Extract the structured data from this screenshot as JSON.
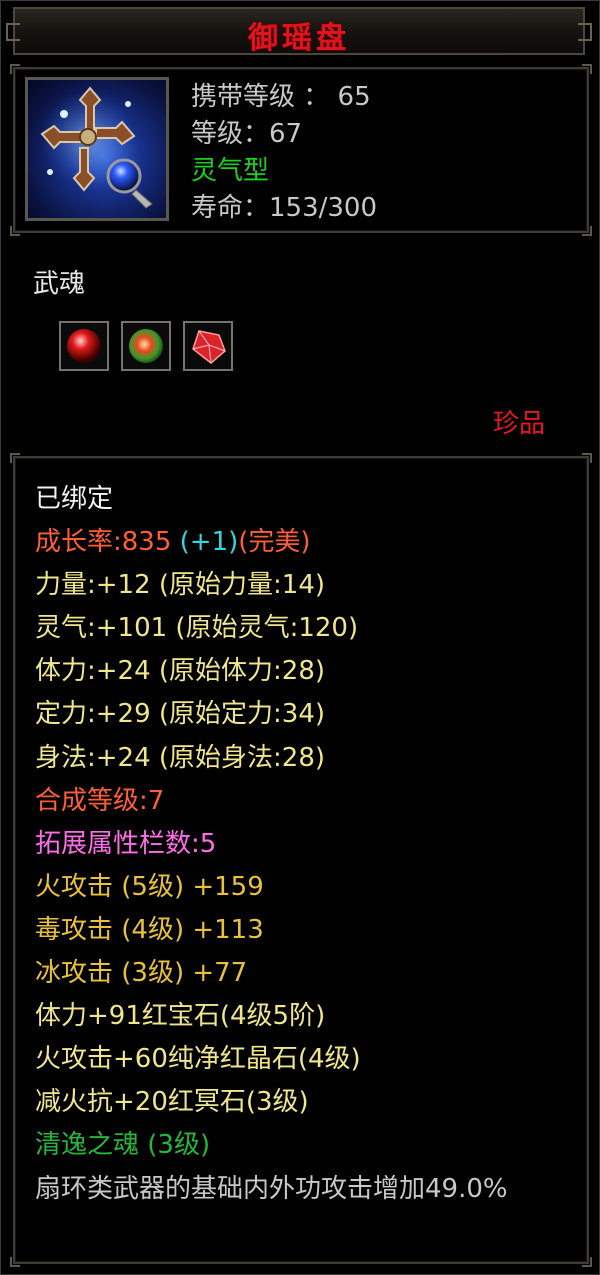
{
  "title": "御瑶盘",
  "item": {
    "icon": "fan-ring-weapon-icon",
    "carry_level": "携带等级 ： 65",
    "level": "等级：67",
    "type": "灵气型",
    "lifespan": "寿命：153/300"
  },
  "soul": {
    "label": "武魂",
    "gems": [
      "red-orb-gem-icon",
      "green-orb-gem-icon",
      "red-crystal-gem-icon"
    ]
  },
  "rarity": "珍品",
  "attributes": {
    "bound": "已绑定",
    "growth_label": "成长率:835 ",
    "growth_bonus": "(+1)",
    "growth_rating": "(完美)",
    "strength": "力量:+12 (原始力量:14)",
    "spirit": "灵气:+101 (原始灵气:120)",
    "stamina": "体力:+24 (原始体力:28)",
    "focus": "定力:+29 (原始定力:34)",
    "agility": "身法:+24 (原始身法:28)",
    "synthesis": "合成等级:7",
    "extend_slots": "拓展属性栏数:5",
    "fire_attack": "火攻击 (5级) +159",
    "poison_attack": "毒攻击 (4级) +113",
    "ice_attack": "冰攻击 (3级) +77",
    "gem1": "体力+91红宝石(4级5阶)",
    "gem2": "火攻击+60纯净红晶石(4级)",
    "gem3": "减火抗+20红冥石(3级)",
    "soul_name": "清逸之魂 (3级)",
    "soul_desc": "扇环类武器的基础内外功攻击增加49.0%"
  },
  "colors": {
    "title": "#e0141c",
    "green": "#18d21e",
    "rarity": "#e8161e",
    "growth": "#ff5e36",
    "bonus": "#2ed8e0",
    "stats": "#f0e68c",
    "extend": "#ff6ee8",
    "element": "#e9c23a",
    "soul": "#22b83a"
  }
}
